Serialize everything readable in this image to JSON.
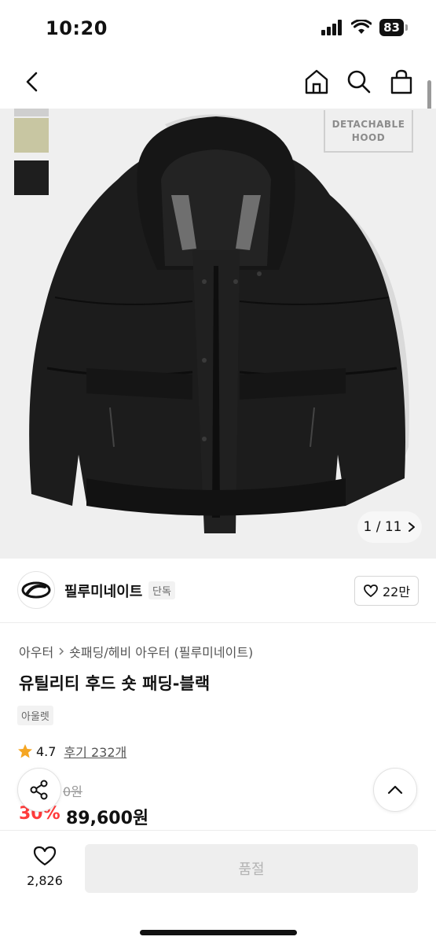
{
  "status_bar": {
    "time": "10:20",
    "battery": "83"
  },
  "hero": {
    "hood_tag_line1": "DETACHABLE",
    "hood_tag_line2": "HOOD",
    "counter": "1 / 11",
    "swatch_colors": [
      "#c8c6a2",
      "#1e1e1e"
    ]
  },
  "brand": {
    "name": "필루미네이트",
    "badge": "단독",
    "likes": "22만"
  },
  "product": {
    "breadcrumb": [
      "아우터",
      "숏패딩/헤비 아우터 (필루미네이트)"
    ],
    "title": "유틸리티 후드 숏 패딩-블랙",
    "tag": "아울렛",
    "rating": "4.7",
    "review_link": "후기 232개",
    "original_price": "0원",
    "discount": "30%",
    "price": "89,600원"
  },
  "bottom": {
    "wish_count": "2,826",
    "button_label": "품절"
  },
  "colors": {
    "discount": "#ff3b3b",
    "star": "#f5a623"
  }
}
